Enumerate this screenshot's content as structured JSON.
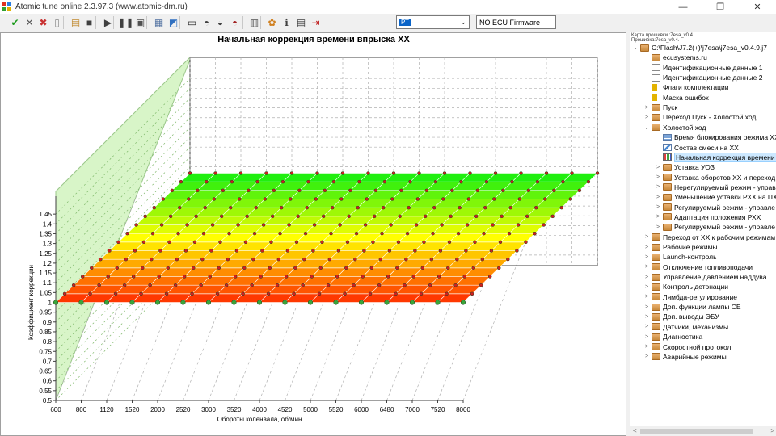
{
  "window": {
    "title": "Atomic tune online 2.3.97.3 (www.atomic-dm.ru)",
    "controls": [
      "—",
      "❐",
      "✕"
    ]
  },
  "toolbar": {
    "buttons": [
      {
        "name": "apply-icon",
        "glyph": "✔",
        "color": "#1a9a1a"
      },
      {
        "name": "tools-icon",
        "glyph": "✕",
        "color": "#555555"
      },
      {
        "name": "cancel-icon",
        "glyph": "✖",
        "color": "#c83030"
      },
      {
        "name": "new-file-icon",
        "glyph": "▯",
        "color": "#888888"
      },
      {
        "name": "open-file-icon",
        "glyph": "▤",
        "color": "#c08a30"
      },
      {
        "name": "save-icon",
        "glyph": "■",
        "color": "#404040"
      },
      {
        "name": "play-icon",
        "glyph": "▶",
        "color": "#404040"
      },
      {
        "name": "pause-icon",
        "glyph": "❚❚",
        "color": "#404040"
      },
      {
        "name": "record-icon",
        "glyph": "▣",
        "color": "#505050"
      },
      {
        "name": "table-icon",
        "glyph": "▦",
        "color": "#5070a0"
      },
      {
        "name": "graph-edit-icon",
        "glyph": "◩",
        "color": "#3070c0"
      },
      {
        "name": "display-icon",
        "glyph": "▭",
        "color": "#303030"
      },
      {
        "name": "car-icon",
        "glyph": "◓",
        "color": "#404040"
      },
      {
        "name": "car-connect-icon",
        "glyph": "◒",
        "color": "#404040"
      },
      {
        "name": "car-red-icon",
        "glyph": "◓",
        "color": "#a02020"
      },
      {
        "name": "building-icon",
        "glyph": "▥",
        "color": "#505050"
      },
      {
        "name": "palette-icon",
        "glyph": "✿",
        "color": "#d08020"
      },
      {
        "name": "info-icon",
        "glyph": "ℹ",
        "color": "#404040"
      },
      {
        "name": "keyboard-icon",
        "glyph": "▤",
        "color": "#404040"
      },
      {
        "name": "exit-icon",
        "glyph": "⇥",
        "color": "#c02020"
      }
    ],
    "port_select": "РТ",
    "firmware_status": "NO ECU Firmware"
  },
  "tree": {
    "info_line1": "Карта прошивки :7esa_v0.4.",
    "info_line2": "Прошивка:7esa_v0.4.",
    "items": [
      {
        "depth": 0,
        "expander": "⌄",
        "icon": "folder",
        "label": "C:\\Flash\\J7.2(+)\\j7esa\\j7esa_v0.4.9.j7"
      },
      {
        "depth": 1,
        "expander": "",
        "icon": "folder",
        "label": "ecusystems.ru"
      },
      {
        "depth": 1,
        "expander": "",
        "icon": "doc",
        "label": "Идентификационные данные 1"
      },
      {
        "depth": 1,
        "expander": "",
        "icon": "doc",
        "label": "Идентификационные данные 2"
      },
      {
        "depth": 1,
        "expander": "",
        "icon": "flag",
        "label": "Флаги комплектации"
      },
      {
        "depth": 1,
        "expander": "",
        "icon": "flag",
        "label": "Маска ошибок"
      },
      {
        "depth": 1,
        "expander": ">",
        "icon": "folder",
        "label": "Пуск"
      },
      {
        "depth": 1,
        "expander": ">",
        "icon": "folder",
        "label": "Переход Пуск - Холостой ход"
      },
      {
        "depth": 1,
        "expander": "⌄",
        "icon": "folder",
        "label": "Холостой ход"
      },
      {
        "depth": 2,
        "expander": "",
        "icon": "grid",
        "label": "Время блокирования режима ХХ"
      },
      {
        "depth": 2,
        "expander": "",
        "icon": "chart",
        "label": "Состав смеси на ХХ"
      },
      {
        "depth": 2,
        "expander": "",
        "icon": "bars",
        "label": "Начальная коррекция времени",
        "selected": true
      },
      {
        "depth": 2,
        "expander": ">",
        "icon": "folder",
        "label": "Уставка УОЗ"
      },
      {
        "depth": 2,
        "expander": ">",
        "icon": "folder",
        "label": "Уставка оборотов ХХ и переход"
      },
      {
        "depth": 2,
        "expander": ">",
        "icon": "folder",
        "label": "Нерегулируемый режим - управ"
      },
      {
        "depth": 2,
        "expander": ">",
        "icon": "folder",
        "label": "Уменьшение уставки РХХ на ПХ"
      },
      {
        "depth": 2,
        "expander": ">",
        "icon": "folder",
        "label": "Регулируемый режим - управле"
      },
      {
        "depth": 2,
        "expander": ">",
        "icon": "folder",
        "label": "Адаптация положения  РХХ"
      },
      {
        "depth": 2,
        "expander": ">",
        "icon": "folder",
        "label": "Регулируемый режим - управле"
      },
      {
        "depth": 1,
        "expander": ">",
        "icon": "folder",
        "label": "Переход от ХХ к рабочим режимам"
      },
      {
        "depth": 1,
        "expander": ">",
        "icon": "folder",
        "label": "Рабочие режимы"
      },
      {
        "depth": 1,
        "expander": ">",
        "icon": "folder",
        "label": "Launch-контроль"
      },
      {
        "depth": 1,
        "expander": ">",
        "icon": "folder",
        "label": "Отключение топливоподачи"
      },
      {
        "depth": 1,
        "expander": ">",
        "icon": "folder",
        "label": "Управление давлением наддува"
      },
      {
        "depth": 1,
        "expander": ">",
        "icon": "folder",
        "label": "Контроль детонации"
      },
      {
        "depth": 1,
        "expander": ">",
        "icon": "folder",
        "label": "Лямбда-регулирование"
      },
      {
        "depth": 1,
        "expander": ">",
        "icon": "folder",
        "label": "Доп. функции лампы СЕ"
      },
      {
        "depth": 1,
        "expander": ">",
        "icon": "folder",
        "label": "Доп. выводы ЭБУ"
      },
      {
        "depth": 1,
        "expander": ">",
        "icon": "folder",
        "label": "Датчики, механизмы"
      },
      {
        "depth": 1,
        "expander": ">",
        "icon": "folder",
        "label": "Диагностика"
      },
      {
        "depth": 1,
        "expander": ">",
        "icon": "folder",
        "label": "Скоростной протокол"
      },
      {
        "depth": 1,
        "expander": ">",
        "icon": "folder",
        "label": "Аварийные режимы"
      }
    ]
  },
  "chart_data": {
    "type": "surface3d",
    "title": "Начальная коррекция времени впрыска ХХ",
    "xlabel": "Обороты коленвала, об/мин",
    "ylabel": "Коэффициент коррекции",
    "x_ticks": [
      "600",
      "800",
      "1120",
      "1520",
      "2000",
      "2520",
      "3000",
      "3520",
      "4000",
      "4520",
      "5000",
      "5520",
      "6000",
      "6480",
      "7000",
      "7520",
      "8000"
    ],
    "y_ticks": [
      "0.5",
      "0.55",
      "0.6",
      "0.65",
      "0.7",
      "0.75",
      "0.8",
      "0.85",
      "0.9",
      "0.95",
      "1",
      "1.05",
      "1.1",
      "1.15",
      "1.2",
      "1.25",
      "1.3",
      "1.35",
      "1.4",
      "1.45"
    ],
    "ylim": [
      0.5,
      1.5
    ],
    "z_rows": 16,
    "value": 1.0,
    "colors": {
      "low": "#ff2a00",
      "mid": "#ffff00",
      "high": "#10ee10",
      "point_low": "#3aa53a",
      "point_high": "#d02020"
    }
  }
}
